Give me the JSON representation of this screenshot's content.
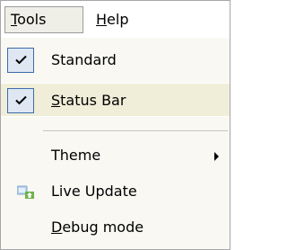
{
  "menubar": {
    "items": [
      {
        "label_underlined": "T",
        "label_rest": "ools",
        "active": true
      },
      {
        "label_underlined": "H",
        "label_rest": "elp",
        "active": false
      }
    ]
  },
  "dropdown": {
    "items": [
      {
        "label_pre": "Standard",
        "label_underlined": "",
        "label_rest": "",
        "checked": true,
        "icon": "check-icon"
      },
      {
        "label_pre": "",
        "label_underlined": "S",
        "label_rest": "tatus Bar",
        "checked": true,
        "icon": "check-icon"
      },
      {
        "label_pre": "Theme",
        "label_underlined": "",
        "label_rest": "",
        "submenu": true,
        "icon": "submenu-arrow-icon"
      },
      {
        "label_pre": "Live Update",
        "label_underlined": "",
        "label_rest": "",
        "icon": "live-update-icon"
      },
      {
        "label_pre": "",
        "label_underlined": "D",
        "label_rest": "ebug mode",
        "icon": ""
      }
    ]
  },
  "colors": {
    "menu_background": "#f9f8f3",
    "highlight": "#f0eed9",
    "check_border": "#3c6cab",
    "check_fill": "#dfe7f3"
  }
}
